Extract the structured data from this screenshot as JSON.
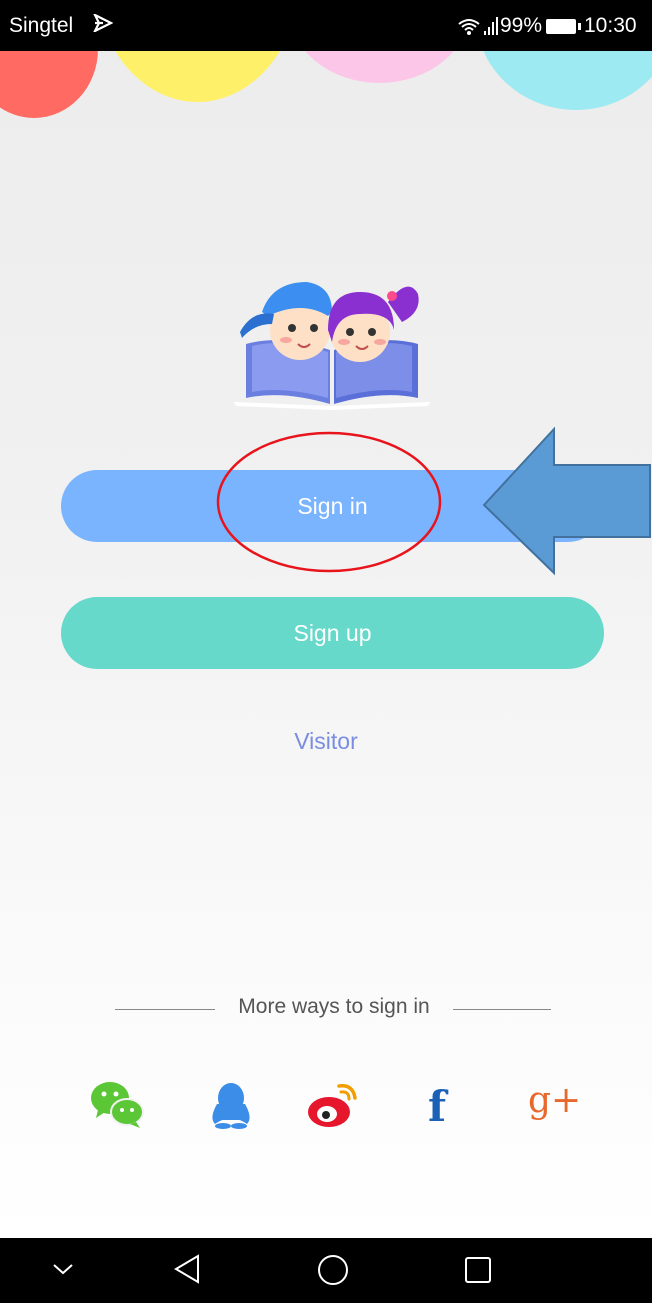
{
  "status_bar": {
    "carrier": "Singtel",
    "battery": "99%",
    "time": "10:30",
    "icons": [
      "carrier-flag-icon",
      "wifi-icon",
      "signal-icon",
      "battery-icon"
    ]
  },
  "logo": {
    "icon": "kids-reading-book-logo"
  },
  "buttons": {
    "sign_in": "Sign in",
    "sign_up": "Sign up",
    "visitor": "Visitor"
  },
  "more_ways": {
    "label": "More ways to sign in"
  },
  "social": [
    {
      "icon": "wechat-icon",
      "color": "#5bc636"
    },
    {
      "icon": "qq-icon",
      "color": "#3c8de8"
    },
    {
      "icon": "weibo-icon",
      "color": "#e6162d"
    },
    {
      "icon": "facebook-icon",
      "glyph": "f",
      "color": "#1b62b7"
    },
    {
      "icon": "google-plus-icon",
      "glyph": "g+",
      "color": "#e8672a"
    }
  ],
  "nav_bar": {
    "icons": [
      "collapse-icon",
      "back-icon",
      "home-icon",
      "recents-icon"
    ]
  },
  "colors": {
    "sign_in": "#7ab4ff",
    "sign_up": "#66d9cb",
    "visitor": "#7a8de0",
    "annotation_circle": "#e8141c",
    "annotation_arrow": "#5b9bd5"
  }
}
